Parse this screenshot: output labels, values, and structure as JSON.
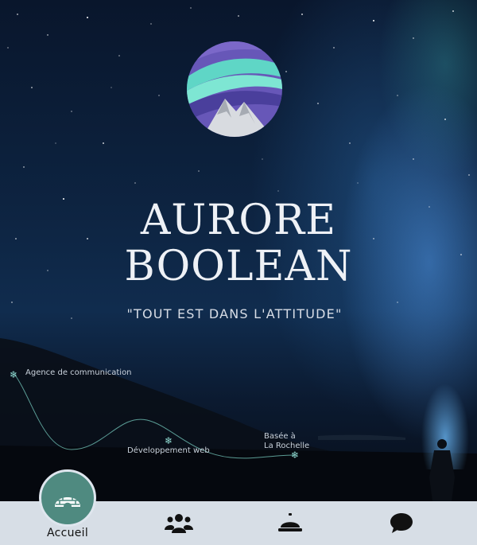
{
  "brand": {
    "title_line1": "AURORE",
    "title_line2": "BOOLEAN",
    "tagline": "\"TOUT EST DANS L'ATTITUDE\""
  },
  "timeline": {
    "stop1": "Agence de communication",
    "stop2": "Développement web",
    "stop3_line1": "Basée à",
    "stop3_line2": "La Rochelle"
  },
  "nav": {
    "items": [
      {
        "label": "Accueil",
        "icon": "igloo-icon",
        "active": true
      },
      {
        "label": "",
        "icon": "users-icon",
        "active": false
      },
      {
        "label": "",
        "icon": "concierge-bell-icon",
        "active": false
      },
      {
        "label": "",
        "icon": "chat-bubble-icon",
        "active": false
      }
    ]
  },
  "colors": {
    "accent": "#4f8a80",
    "navbar": "#d7dee6",
    "timeline_line": "#6fbfb4"
  }
}
